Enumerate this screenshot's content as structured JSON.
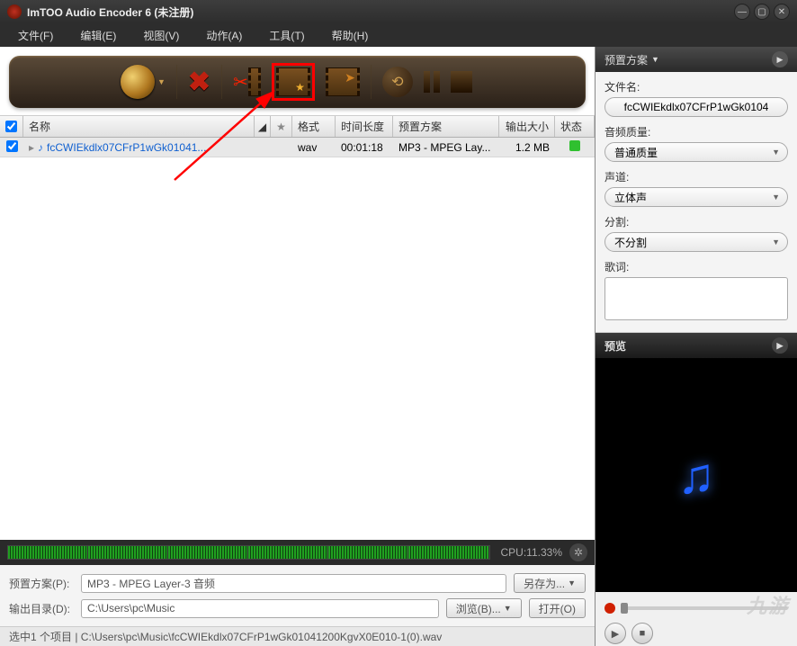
{
  "titlebar": {
    "title": "ImTOO Audio Encoder 6 (未注册)"
  },
  "menu": {
    "file": "文件(F)",
    "edit": "编辑(E)",
    "view": "视图(V)",
    "action": "动作(A)",
    "tools": "工具(T)",
    "help": "帮助(H)"
  },
  "columns": {
    "name": "名称",
    "format": "格式",
    "duration": "时间长度",
    "preset": "预置方案",
    "outsize": "输出大小",
    "status": "状态"
  },
  "rows": [
    {
      "name": "fcCWIEkdlx07CFrP1wGk01041...",
      "format": "wav",
      "duration": "00:01:18",
      "preset": "MP3 - MPEG Lay...",
      "outsize": "1.2 MB"
    }
  ],
  "cpu": {
    "label": "CPU:11.33%"
  },
  "bottom": {
    "preset_label": "预置方案(P):",
    "preset_value": "MP3 - MPEG Layer-3 音频",
    "saveas": "另存为...",
    "outdir_label": "输出目录(D):",
    "outdir_value": "C:\\Users\\pc\\Music",
    "browse": "浏览(B)...",
    "open": "打开(O)"
  },
  "statusline": "选中1 个项目 | C:\\Users\\pc\\Music\\fcCWIEkdlx07CFrP1wGk01041200KgvX0E010-1(0).wav",
  "right": {
    "preset_header": "预置方案",
    "filename_label": "文件名:",
    "filename_value": "fcCWIEkdlx07CFrP1wGk0104",
    "quality_label": "音频质量:",
    "quality_value": "普通质量",
    "channel_label": "声道:",
    "channel_value": "立体声",
    "split_label": "分割:",
    "split_value": "不分割",
    "lyrics_label": "歌词:",
    "preview_header": "预览"
  },
  "watermark": "九游"
}
